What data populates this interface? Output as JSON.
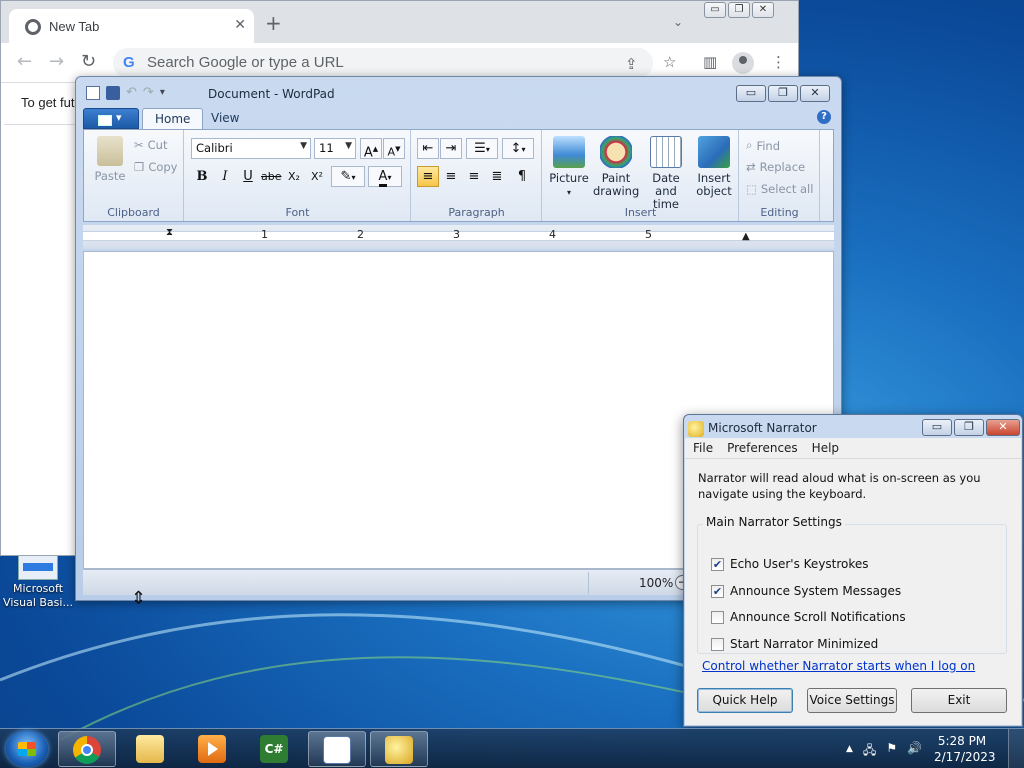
{
  "desktop": {
    "icon_label": "Microsoft Visual Basi..."
  },
  "chrome": {
    "tab_title": "New Tab",
    "tab_close": "✕",
    "new_tab": "+",
    "omnibox_placeholder": "Search Google or type a URL",
    "g_logo": "G",
    "infobar_text": "To get fut",
    "win_buttons": [
      "▭",
      "❐",
      "✕"
    ]
  },
  "wordpad": {
    "title": "Document - WordPad",
    "tabs": [
      "Home",
      "View"
    ],
    "help": "?",
    "clipboard": {
      "paste": "Paste",
      "cut": "Cut",
      "copy": "Copy",
      "label": "Clipboard"
    },
    "font": {
      "family": "Calibri",
      "size": "11",
      "label": "Font",
      "buttons": [
        "B",
        "I",
        "U",
        "abe",
        "X₂",
        "X²"
      ]
    },
    "paragraph": {
      "label": "Paragraph"
    },
    "insert": {
      "label": "Insert",
      "picture": "Picture",
      "paint": "Paint drawing",
      "datetime": "Date and time",
      "object": "Insert object"
    },
    "editing": {
      "label": "Editing",
      "find": "Find",
      "replace": "Replace",
      "select_all": "Select all"
    },
    "ruler_numbers": [
      "1",
      "2",
      "3",
      "4",
      "5"
    ],
    "zoom": "100%",
    "win_buttons": [
      "▭",
      "❐",
      "✕"
    ]
  },
  "narrator": {
    "title": "Microsoft Narrator",
    "menu": [
      "File",
      "Preferences",
      "Help"
    ],
    "intro": "Narrator will read aloud what is on-screen as you navigate using the keyboard.",
    "group_title": "Main Narrator Settings",
    "options": [
      {
        "label": "Echo User's Keystrokes",
        "checked": true
      },
      {
        "label": "Announce System Messages",
        "checked": true
      },
      {
        "label": "Announce Scroll Notifications",
        "checked": false
      },
      {
        "label": "Start Narrator Minimized",
        "checked": false
      }
    ],
    "link": "Control whether Narrator starts when I log on",
    "buttons": {
      "quick_help": "Quick Help",
      "voice_settings": "Voice Settings",
      "exit": "Exit"
    },
    "win_buttons": [
      "▭",
      "❐",
      "✕"
    ]
  },
  "taskbar": {
    "time": "5:28 PM",
    "date": "2/17/2023",
    "tray_arrow": "▲",
    "apps": [
      "chrome",
      "file-explorer",
      "media-player",
      "visual-csharp",
      "wordpad",
      "narrator"
    ]
  },
  "colors": {
    "desktop_blue": "#1a6fc0",
    "win7_frame": "#c9daf0",
    "chrome_tabstrip": "#dee1e6",
    "link_blue": "#0033cc"
  }
}
